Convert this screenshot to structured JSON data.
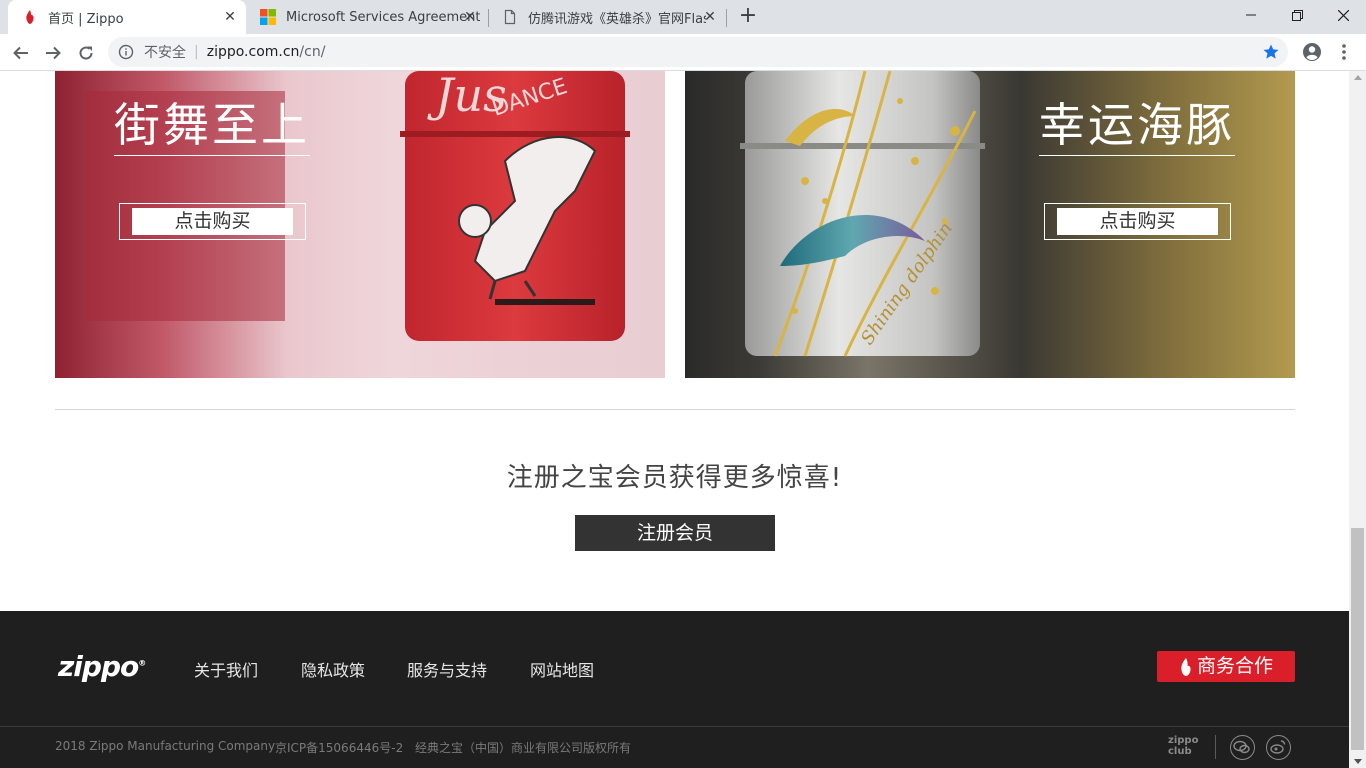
{
  "browser": {
    "tabs": [
      {
        "title": "首页 | Zippo",
        "icon": "zippo-flame-icon",
        "active": true
      },
      {
        "title": "Microsoft Services Agreement",
        "icon": "microsoft-logo-icon",
        "active": false
      },
      {
        "title": "仿腾讯游戏《英雄杀》官网Flash",
        "icon": "document-icon",
        "active": false
      }
    ],
    "address": {
      "security": "不安全",
      "host": "zippo.com.cn",
      "path": "/cn/"
    }
  },
  "promos": [
    {
      "title": "街舞至上",
      "button": "点击购买",
      "image": "red-breakdance-lighter"
    },
    {
      "title": "幸运海豚",
      "button": "点击购买",
      "image": "silver-dolphin-lighter"
    }
  ],
  "signup": {
    "text": "注册之宝会员获得更多惊喜!",
    "button": "注册会员"
  },
  "footer": {
    "logo": "zippo",
    "links": [
      "关于我们",
      "隐私政策",
      "服务与支持",
      "网站地图"
    ],
    "business_button": "商务合作",
    "copyright": [
      "2018 Zippo Manufacturing Company",
      "京ICP备15066446号-2",
      "经典之宝（中国）商业有限公司版权所有"
    ],
    "club_logo": [
      "zippo",
      "club"
    ],
    "social_icons": [
      "wechat-icon",
      "weibo-icon"
    ],
    "accent_color": "#da1f2b"
  }
}
